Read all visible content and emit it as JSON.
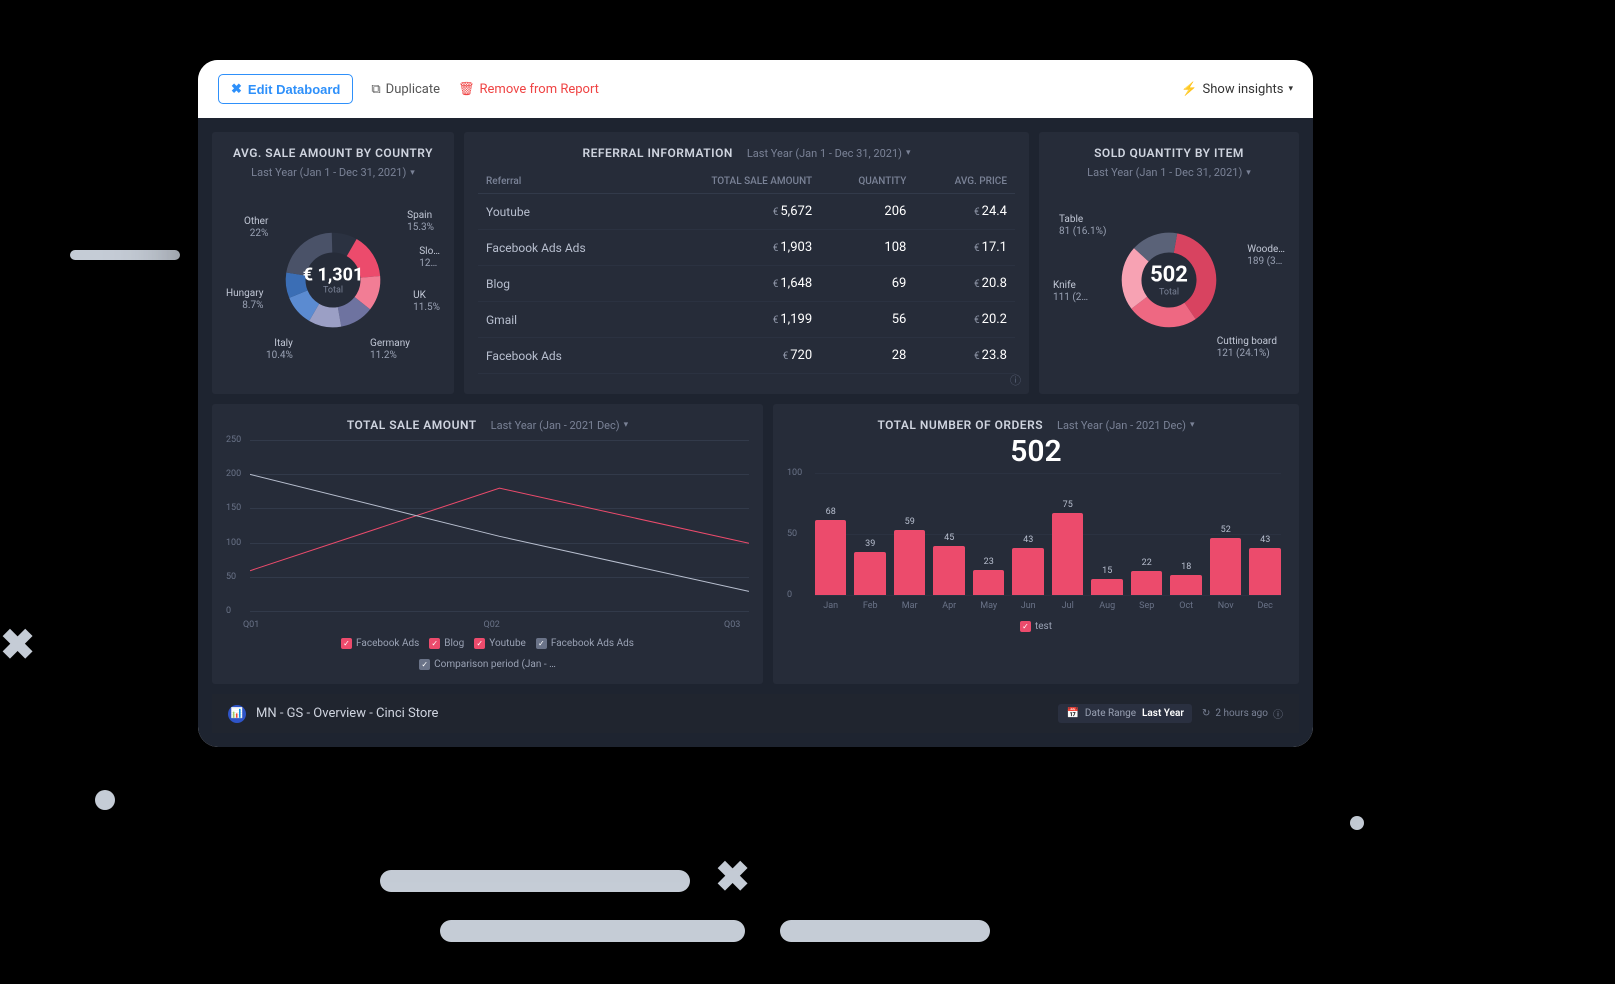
{
  "toolbar": {
    "edit_label": "Edit Databoard",
    "duplicate_label": "Duplicate",
    "remove_label": "Remove from Report",
    "show_insights_label": "Show insights"
  },
  "country_card": {
    "title": "AVG. SALE AMOUNT BY COUNTRY",
    "period": "Last Year (Jan 1 - Dec 31, 2021)",
    "total_label": "Total",
    "total_value": "€ 1,301",
    "slices": [
      {
        "name": "Spain",
        "pct": "15.3%"
      },
      {
        "name": "Slo…",
        "pct": "12…"
      },
      {
        "name": "UK",
        "pct": "11.5%"
      },
      {
        "name": "Germany",
        "pct": "11.2%"
      },
      {
        "name": "Italy",
        "pct": "10.4%"
      },
      {
        "name": "Hungary",
        "pct": "8.7%"
      },
      {
        "name": "Other",
        "pct": "22%"
      }
    ]
  },
  "referral_card": {
    "title": "REFERRAL INFORMATION",
    "period": "Last Year (Jan 1 - Dec 31, 2021)",
    "columns": [
      "Referral",
      "TOTAL SALE AMOUNT",
      "QUANTITY",
      "AVG. PRICE"
    ],
    "rows": [
      {
        "name": "Youtube",
        "total": "5,672",
        "qty": "206",
        "avg": "24.4"
      },
      {
        "name": "Facebook Ads Ads",
        "total": "1,903",
        "qty": "108",
        "avg": "17.1"
      },
      {
        "name": "Blog",
        "total": "1,648",
        "qty": "69",
        "avg": "20.8"
      },
      {
        "name": "Gmail",
        "total": "1,199",
        "qty": "56",
        "avg": "20.2"
      },
      {
        "name": "Facebook Ads",
        "total": "720",
        "qty": "28",
        "avg": "23.8"
      }
    ]
  },
  "sold_card": {
    "title": "SOLD QUANTITY BY ITEM",
    "period": "Last Year (Jan 1 - Dec 31, 2021)",
    "total_label": "Total",
    "total_value": "502",
    "slices": [
      {
        "name": "Table",
        "val": "81 (16.1%)"
      },
      {
        "name": "Woode…",
        "val": "189 (3…"
      },
      {
        "name": "Cutting board",
        "val": "121 (24.1%)"
      },
      {
        "name": "Knife",
        "val": "111 (2…"
      }
    ]
  },
  "line_card": {
    "title": "TOTAL SALE AMOUNT",
    "period": "Last Year (Jan - 2021 Dec)",
    "legend": [
      "Facebook Ads",
      "Blog",
      "Youtube",
      "Facebook Ads Ads"
    ],
    "legend_compare": "Comparison period (Jan - …"
  },
  "bar_card": {
    "title": "TOTAL NUMBER OF ORDERS",
    "period": "Last Year (Jan - 2021 Dec)",
    "total": "502",
    "legend": "test"
  },
  "footer": {
    "title": "MN - GS - Overview - Cinci Store",
    "range_label": "Date Range",
    "range_value": "Last Year",
    "updated": "2 hours ago"
  },
  "chart_data": [
    {
      "type": "pie",
      "title": "AVG. SALE AMOUNT BY COUNTRY",
      "total": 1301,
      "series": [
        {
          "name": "Spain",
          "value": 15.3
        },
        {
          "name": "Slovenia",
          "value": 12
        },
        {
          "name": "UK",
          "value": 11.5
        },
        {
          "name": "Germany",
          "value": 11.2
        },
        {
          "name": "Italy",
          "value": 10.4
        },
        {
          "name": "Hungary",
          "value": 8.7
        },
        {
          "name": "Other",
          "value": 22
        }
      ]
    },
    {
      "type": "table",
      "title": "REFERRAL INFORMATION",
      "columns": [
        "Referral",
        "TOTAL SALE AMOUNT",
        "QUANTITY",
        "AVG. PRICE"
      ],
      "rows": [
        [
          "Youtube",
          5672,
          206,
          24.4
        ],
        [
          "Facebook Ads Ads",
          1903,
          108,
          17.1
        ],
        [
          "Blog",
          1648,
          69,
          20.8
        ],
        [
          "Gmail",
          1199,
          56,
          20.2
        ],
        [
          "Facebook Ads",
          720,
          28,
          23.8
        ]
      ]
    },
    {
      "type": "pie",
      "title": "SOLD QUANTITY BY ITEM",
      "total": 502,
      "series": [
        {
          "name": "Table",
          "value": 81,
          "pct": 16.1
        },
        {
          "name": "Wooden",
          "value": 189
        },
        {
          "name": "Cutting board",
          "value": 121,
          "pct": 24.1
        },
        {
          "name": "Knife",
          "value": 111
        }
      ]
    },
    {
      "type": "line",
      "title": "TOTAL SALE AMOUNT",
      "x": [
        "Q01",
        "Q02",
        "Q03"
      ],
      "ylim": [
        0,
        250
      ],
      "series": [
        {
          "name": "Pink",
          "values": [
            60,
            180,
            100
          ]
        },
        {
          "name": "Comparison",
          "values": [
            200,
            110,
            30
          ]
        }
      ]
    },
    {
      "type": "bar",
      "title": "TOTAL NUMBER OF ORDERS",
      "categories": [
        "Jan",
        "Feb",
        "Mar",
        "Apr",
        "May",
        "Jun",
        "Jul",
        "Aug",
        "Sep",
        "Oct",
        "Nov",
        "Dec"
      ],
      "values": [
        68,
        39,
        59,
        45,
        23,
        43,
        75,
        15,
        22,
        18,
        52,
        43
      ],
      "ylim": [
        0,
        100
      ],
      "total": 502
    }
  ]
}
